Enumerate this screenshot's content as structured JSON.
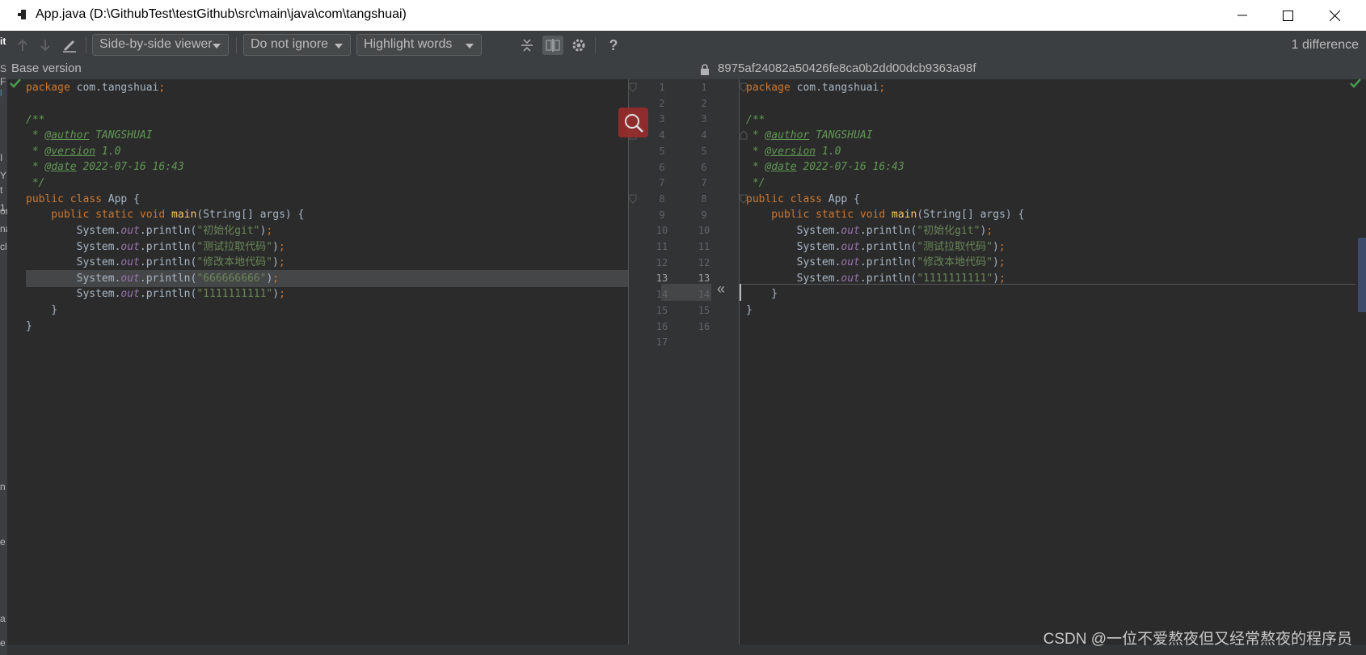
{
  "window": {
    "title": "App.java (D:\\GithubTest\\testGithub\\src\\main\\java\\com\\tangshuai)"
  },
  "toolbar": {
    "viewer_label": "Side-by-side viewer",
    "ignore_label": "Do not ignore",
    "highlight_label": "Highlight words",
    "help_label": "?",
    "diff_count": "1 difference"
  },
  "headers": {
    "left": "Base version",
    "right": "8975af24082a50426fe8ca0b2dd00dcb9363a98f"
  },
  "left_pane": {
    "line_numbers": [
      "1",
      "2",
      "3",
      "4",
      "5",
      "6",
      "7",
      "8",
      "9",
      "10",
      "11",
      "12",
      "13",
      "14",
      "15",
      "16",
      "17"
    ],
    "changed_line": "13"
  },
  "right_pane": {
    "line_numbers": [
      "1",
      "2",
      "3",
      "4",
      "5",
      "6",
      "7",
      "8",
      "9",
      "10",
      "11",
      "12",
      "13",
      "14",
      "15",
      "16"
    ],
    "changed_line": "13"
  },
  "code": {
    "package_kw": "package",
    "package_name": " com.tangshuai",
    "semicolon": ";",
    "doc_open": "/**",
    "doc_star": " * ",
    "author_tag": "@author",
    "author_val": " TANGSHUAI",
    "version_tag": "@version",
    "version_val": " 1.0",
    "date_tag": "@date",
    "date_val": " 2022-07-16 16:43",
    "doc_close": " */",
    "class_kw": "public class",
    "class_name": " App {",
    "method_mods": "    public static void",
    "method_sp": " ",
    "method_name": "main",
    "method_args": "(String[] args) {",
    "sysout_a": "        System.",
    "sysout_out": "out",
    "sysout_b": ".println(",
    "str_init": "\"初始化git\"",
    "str_fetch": "\"测试拉取代码\"",
    "str_modify": "\"修改本地代码\"",
    "str_six": "\"666666666\"",
    "str_ones": "\"1111111111\"",
    "close_paren": ")",
    "close_method": "    }",
    "close_class": "}"
  },
  "left_strip_chars": [
    "it",
    "S",
    "F",
    "l",
    "I",
    "Y",
    "t",
    "1",
    "or",
    "na",
    "cl",
    "n",
    "e",
    "a",
    "e"
  ],
  "watermark": "CSDN @一位不爱熬夜但又经常熬夜的程序员"
}
